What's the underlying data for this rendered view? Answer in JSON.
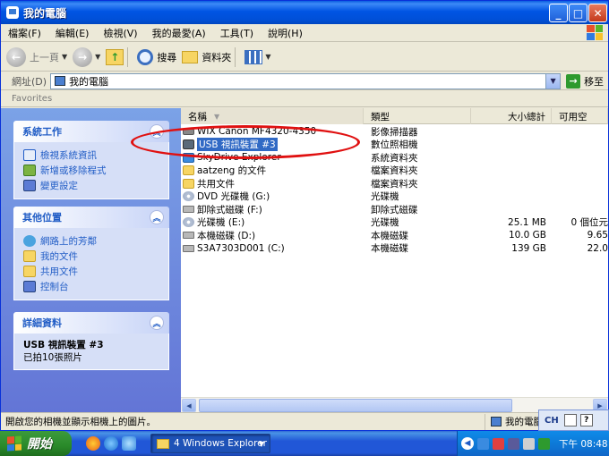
{
  "window": {
    "title": "我的電腦"
  },
  "menu": [
    "檔案(F)",
    "編輯(E)",
    "檢視(V)",
    "我的最愛(A)",
    "工具(T)",
    "說明(H)"
  ],
  "toolbar": {
    "back": "上一頁",
    "search": "搜尋",
    "folders": "資料夾"
  },
  "address": {
    "label": "網址(D)",
    "value": "我的電腦",
    "go": "移至"
  },
  "links": {
    "label": "Favorites"
  },
  "tasks": {
    "title": "系統工作",
    "items": [
      "檢視系統資訊",
      "新增或移除程式",
      "變更設定"
    ]
  },
  "places": {
    "title": "其他位置",
    "items": [
      "網路上的芳鄰",
      "我的文件",
      "共用文件",
      "控制台"
    ]
  },
  "details": {
    "title": "詳細資料",
    "name": "USB 視訊裝置 #3",
    "desc": "已拍10張照片"
  },
  "columns": {
    "name": "名稱",
    "type": "類型",
    "size": "大小總計",
    "free": "可用空"
  },
  "rows": [
    {
      "name": "WIX Canon MF4320-4350",
      "type": "影像掃描器",
      "size": "",
      "free": "",
      "icon": "scanner"
    },
    {
      "name": "USB 視訊裝置 #3",
      "type": "數位照相機",
      "size": "",
      "free": "",
      "icon": "camera"
    },
    {
      "name": "SkyDrive Explorer",
      "type": "系統資料夾",
      "size": "",
      "free": "",
      "icon": "sky"
    },
    {
      "name": "aatzeng 的文件",
      "type": "檔案資料夾",
      "size": "",
      "free": "",
      "icon": "folder"
    },
    {
      "name": "共用文件",
      "type": "檔案資料夾",
      "size": "",
      "free": "",
      "icon": "folder"
    },
    {
      "name": "DVD 光碟機 (G:)",
      "type": "光碟機",
      "size": "",
      "free": "",
      "icon": "cd"
    },
    {
      "name": "卸除式磁碟 (F:)",
      "type": "卸除式磁碟",
      "size": "",
      "free": "",
      "icon": "drive"
    },
    {
      "name": "光碟機 (E:)",
      "type": "光碟機",
      "size": "25.1 MB",
      "free": "0 個位元",
      "icon": "cd"
    },
    {
      "name": "本機磁碟 (D:)",
      "type": "本機磁碟",
      "size": "10.0 GB",
      "free": "9.65",
      "icon": "drive"
    },
    {
      "name": "S3A7303D001 (C:)",
      "type": "本機磁碟",
      "size": "139 GB",
      "free": "22.0",
      "icon": "drive"
    }
  ],
  "status": {
    "text": "開啟您的相機並顯示相機上的圖片。",
    "location": "我的電腦"
  },
  "langbar": {
    "lang": "CH"
  },
  "taskbar": {
    "start": "開始",
    "task": "4 Windows Explorer",
    "clock": "下午 08:48"
  },
  "colors": {
    "accent": "#316ac5",
    "title": "#0054e3",
    "annotation_ring": "#e01010"
  }
}
